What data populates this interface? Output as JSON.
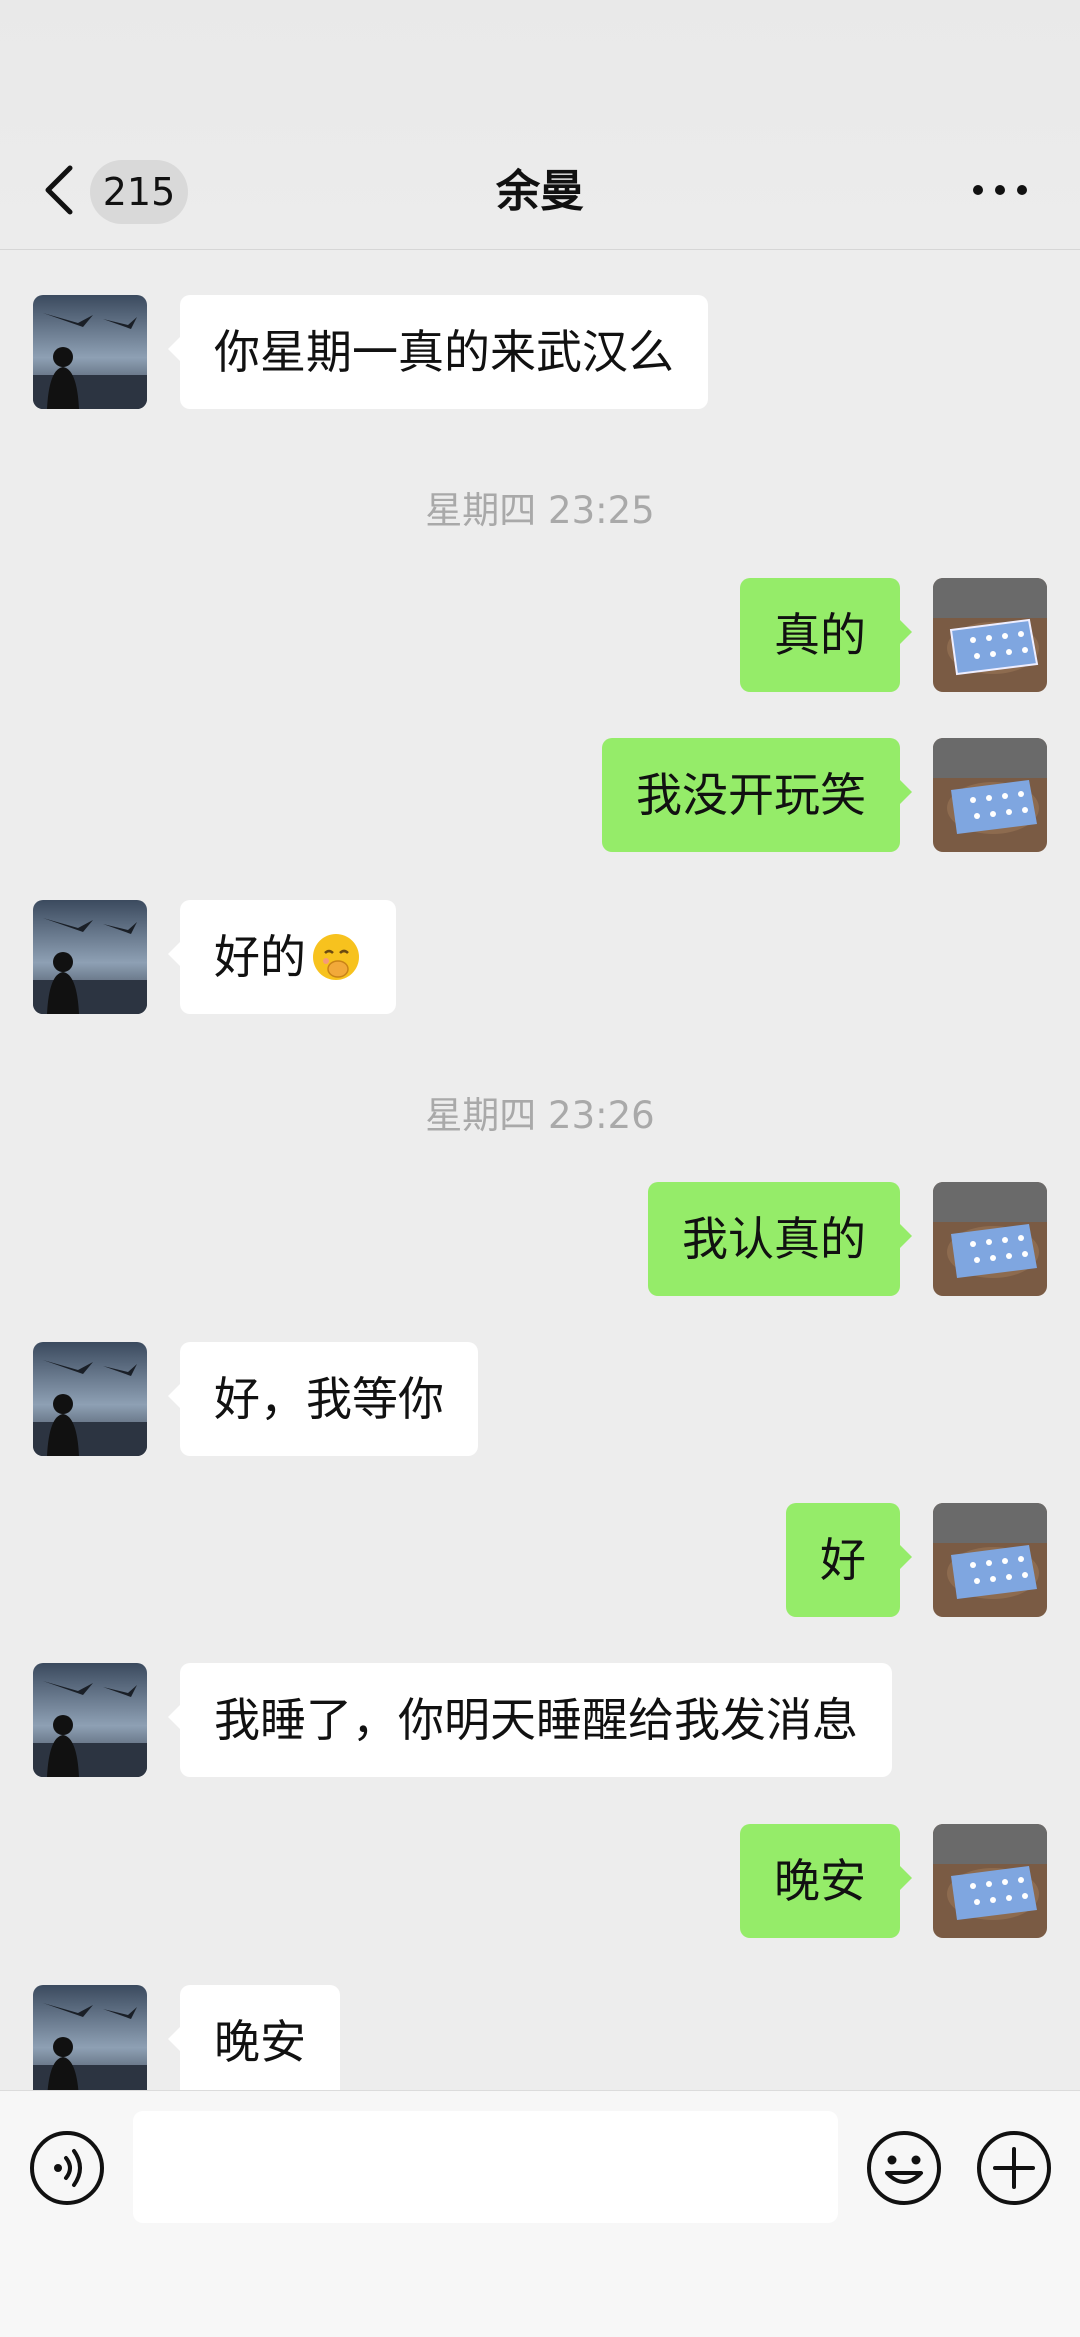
{
  "header": {
    "unread_count": "215",
    "title": "余曼",
    "back_icon": "chevron-left-icon",
    "more_icon": "more-dots-icon"
  },
  "messages": [
    {
      "side": "in",
      "text": "你星期一真的来武汉么"
    },
    {
      "time": "星期四 23:25"
    },
    {
      "side": "out",
      "text": "真的"
    },
    {
      "side": "out",
      "text": "我没开玩笑"
    },
    {
      "side": "in",
      "text": "好的",
      "emoji": "shy-face-emoji"
    },
    {
      "time": "星期四 23:26"
    },
    {
      "side": "out",
      "text": "我认真的"
    },
    {
      "side": "in",
      "text": "好，我等你"
    },
    {
      "side": "out",
      "text": "好"
    },
    {
      "side": "in",
      "text": "我睡了，你明天睡醒给我发消息"
    },
    {
      "side": "out",
      "text": "晚安"
    },
    {
      "side": "in",
      "text": "晚安"
    }
  ],
  "input_bar": {
    "text_value": "",
    "voice_icon": "voice-icon",
    "emoji_icon": "emoji-icon",
    "plus_icon": "plus-icon"
  },
  "colors": {
    "background": "#ededed",
    "outgoing_bubble": "#95ec69",
    "incoming_bubble": "#ffffff",
    "timestamp_text": "#a9a9a9"
  }
}
